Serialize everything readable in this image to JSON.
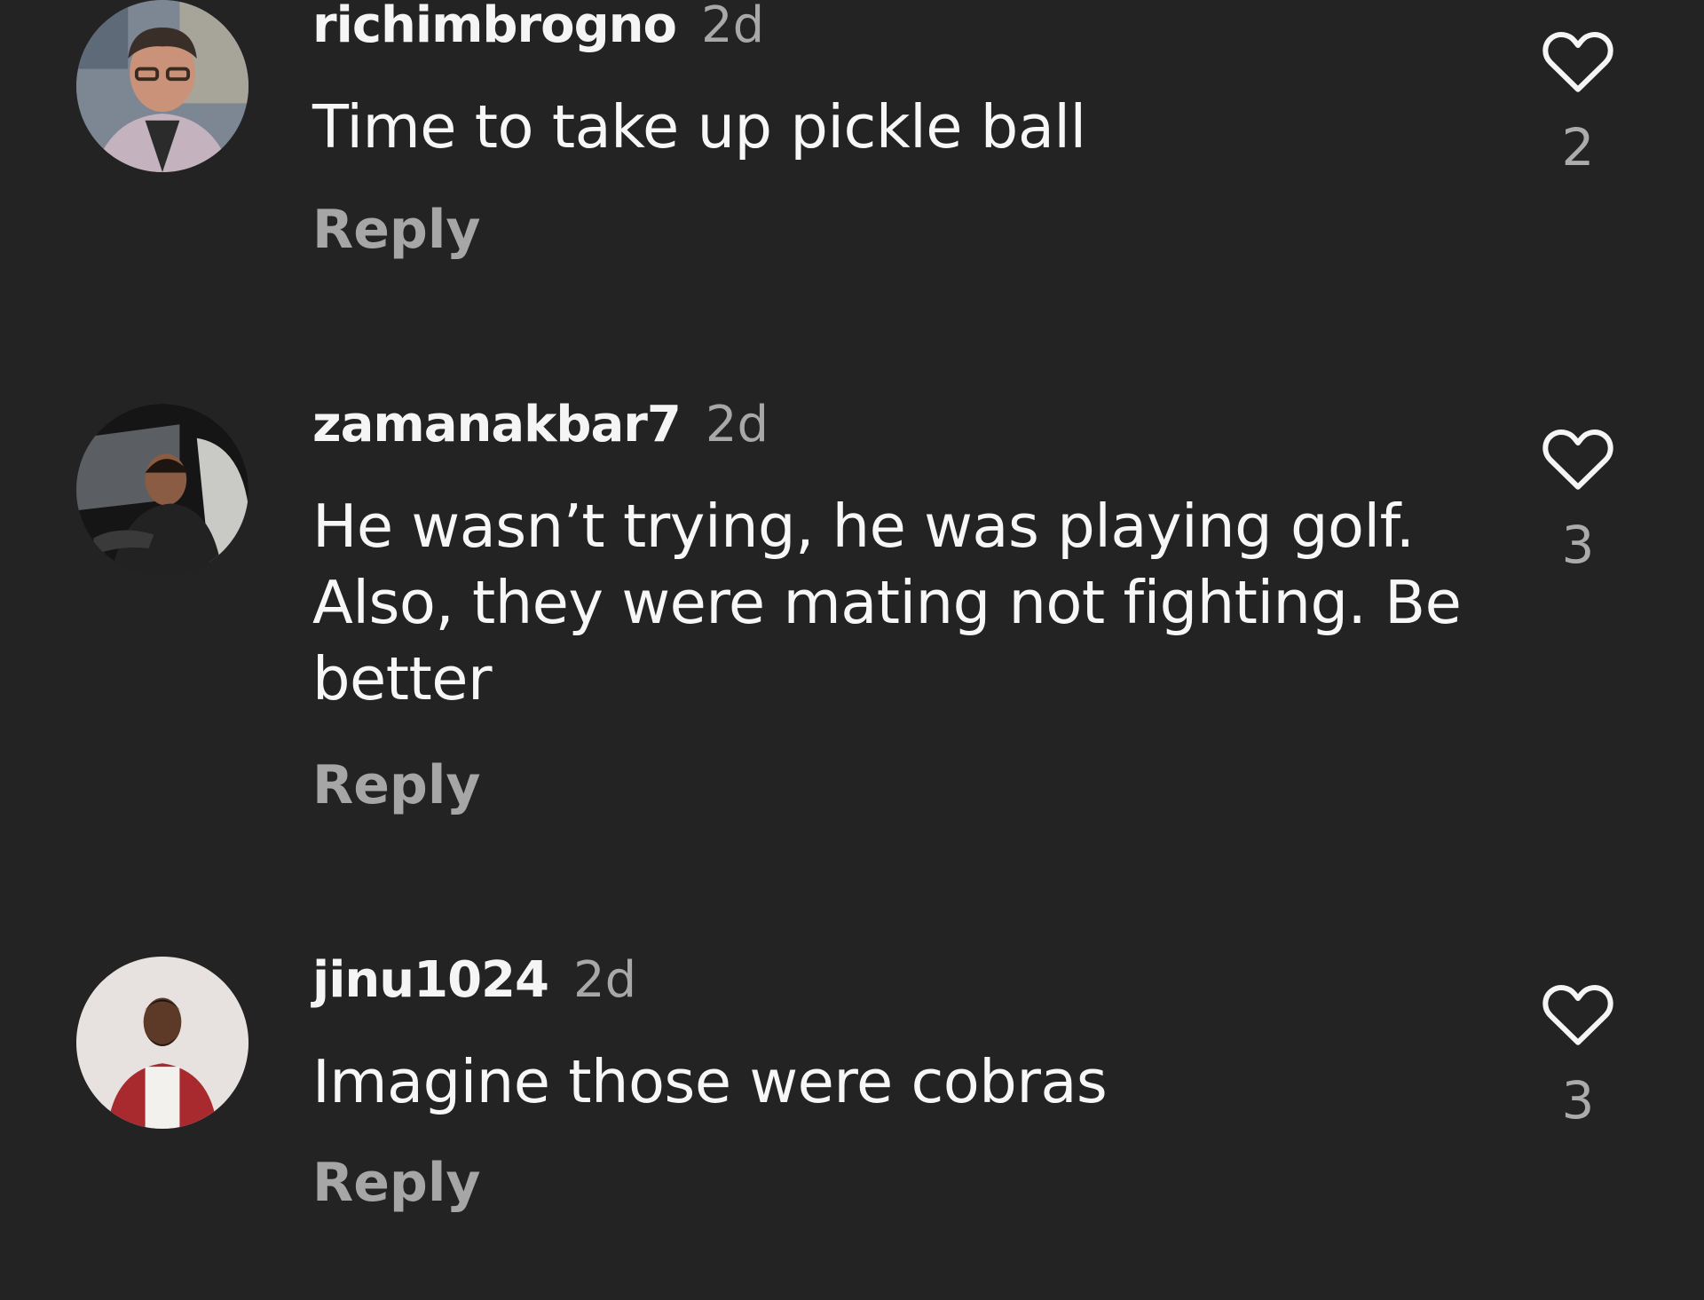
{
  "comments": [
    {
      "username": "richimbrogno",
      "age": "2d",
      "text": "Time to take up pickle ball",
      "reply_label": "Reply",
      "like_icon": "heart-outline-icon",
      "likes": "2"
    },
    {
      "username": "zamanakbar7",
      "age": "2d",
      "text": "He wasn’t trying, he was playing golf. Also, they were mating not fighting. Be better",
      "reply_label": "Reply",
      "like_icon": "heart-outline-icon",
      "likes": "3"
    },
    {
      "username": "jinu1024",
      "age": "2d",
      "text": "Imagine those were cobras",
      "reply_label": "Reply",
      "like_icon": "heart-outline-icon",
      "likes": "3"
    }
  ],
  "colors": {
    "background": "#232323",
    "text_primary": "#f5f5f5",
    "text_secondary": "#a8a8a8"
  }
}
